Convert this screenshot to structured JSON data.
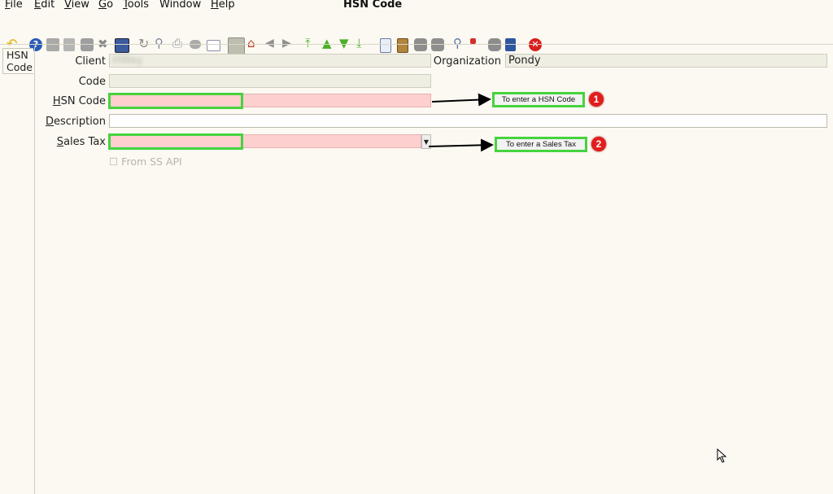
{
  "menubar": {
    "file": {
      "mnemonic": "F",
      "rest": "ile"
    },
    "edit": {
      "mnemonic": "E",
      "rest": "dit"
    },
    "view": {
      "mnemonic": "V",
      "rest": "iew"
    },
    "go": {
      "mnemonic": "G",
      "rest": "o"
    },
    "tools": {
      "mnemonic": "T",
      "rest": "ools"
    },
    "window": "Window",
    "help": {
      "mnemonic": "H",
      "rest": "elp"
    }
  },
  "window_title": "HSN Code",
  "side_tab": {
    "line1": "HSN",
    "line2": "Code"
  },
  "toolbar_icons": [
    "undo-icon",
    "help-icon",
    "new-icon",
    "copy-icon",
    "delete-icon",
    "delete-selection-icon",
    "save-icon",
    "refresh-icon",
    "find-icon",
    "attachment-icon",
    "chat-icon",
    "history-icon",
    "private-access-icon",
    "home-icon",
    "back-icon",
    "forward-icon",
    "first-record-icon",
    "previous-record-icon",
    "next-record-icon",
    "last-record-icon",
    "report-icon",
    "archive-icon",
    "print-preview-icon",
    "print-icon",
    "zoom-across-icon",
    "workflow-icon",
    "request-icon",
    "product-info-icon",
    "close-window-icon"
  ],
  "form": {
    "client": {
      "label": "Client",
      "value": "HWay"
    },
    "organization": {
      "label": "Organization",
      "value": "Pondy"
    },
    "code": {
      "label": "Code",
      "value": ""
    },
    "hsn_code": {
      "label_mnemonic": "H",
      "label_rest": "SN Code",
      "value": ""
    },
    "description": {
      "label_mnemonic": "D",
      "label_rest": "escription",
      "value": ""
    },
    "sales_tax": {
      "label_mnemonic": "S",
      "label_rest": "ales Tax",
      "value": ""
    },
    "from_ss_api": {
      "label": "☐ From SS API",
      "checked": false
    }
  },
  "annotations": [
    {
      "number": "1",
      "text": "To enter a HSN Code"
    },
    {
      "number": "2",
      "text": "To enter a Sales Tax"
    }
  ],
  "colors": {
    "required_field": "#fdcfcf",
    "highlight": "#46d33f",
    "badge": "#e11d1d"
  }
}
